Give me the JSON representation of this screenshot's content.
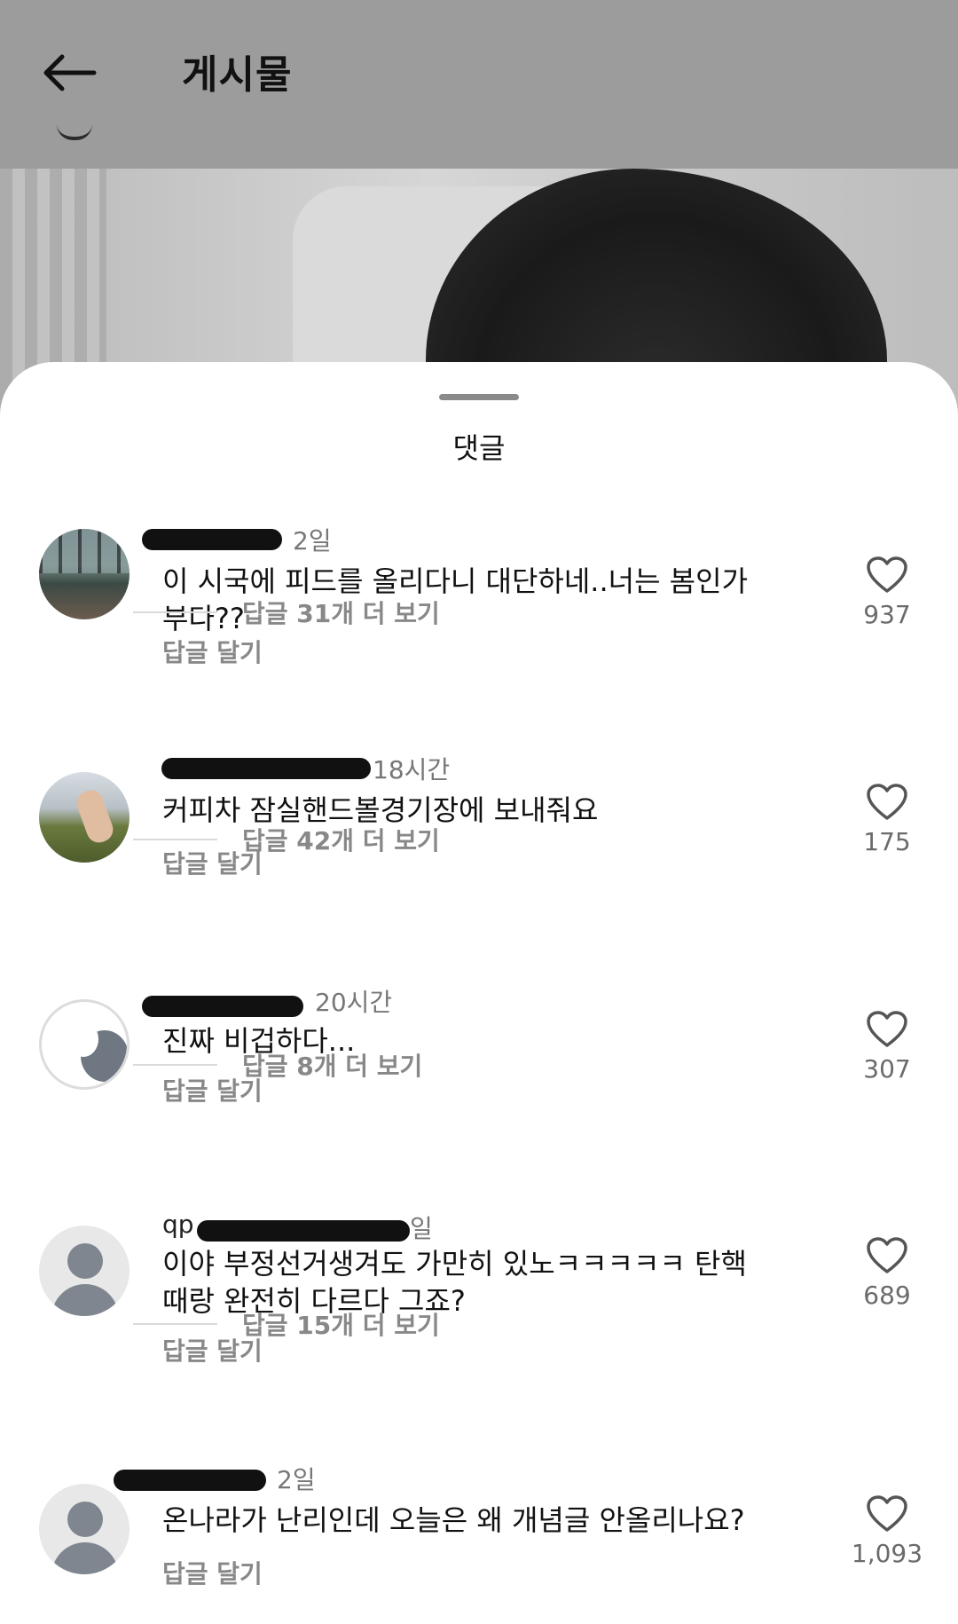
{
  "header": {
    "title": "게시물"
  },
  "sheet": {
    "title": "댓글"
  },
  "reply_label": "답글 달기",
  "comments": [
    {
      "username": "",
      "time": "2일",
      "text": "이 시국에 피드를 올리다니 대단하네..너는 봄인가부다??",
      "likes": "937",
      "more_replies": "답글 31개 더 보기",
      "avatar": "photo-lake"
    },
    {
      "username": "",
      "time": "18시간",
      "text": "커피차 잠실핸드볼경기장에 보내줘요",
      "likes": "175",
      "more_replies": "답글 42개 더 보기",
      "avatar": "photo-peace-sign"
    },
    {
      "username": "",
      "time": "20시간",
      "text": "진짜 비겁하다...",
      "likes": "307",
      "more_replies": "답글 8개 더 보기",
      "avatar": "moon"
    },
    {
      "username": "qp",
      "time": "일",
      "text": "이야 부정선거생겨도 가만히 있노ㅋㅋㅋㅋㅋ 탄핵때랑 완전히 다르다 그죠?",
      "likes": "689",
      "more_replies": "답글 15개 더 보기",
      "avatar": "default-person"
    },
    {
      "username": "",
      "time": "2일",
      "text": "온나라가 난리인데 오늘은 왜 개념글 안올리나요?",
      "likes": "1,093",
      "more_replies": "",
      "avatar": "default-person"
    }
  ]
}
